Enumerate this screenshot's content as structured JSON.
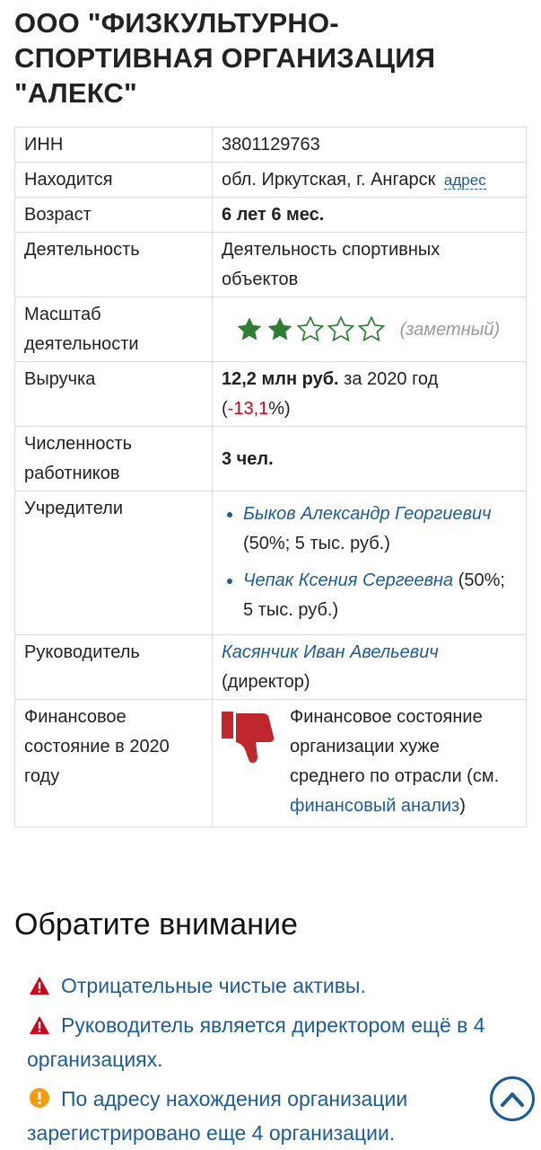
{
  "page_title": "ООО \"ФИЗКУЛЬТУРНО-СПОРТИВНАЯ ОРГАНИЗАЦИЯ \"АЛЕКС\"",
  "info": {
    "inn": {
      "label": "ИНН",
      "value": "3801129763"
    },
    "location": {
      "label": "Находится",
      "value": "обл. Иркутская, г. Ангарск",
      "link": "адрес"
    },
    "age": {
      "label": "Возраст",
      "value": "6 лет 6 мес."
    },
    "activity": {
      "label": "Деятельность",
      "value": "Деятельность спортивных объектов"
    },
    "scale": {
      "label": "Масштаб деятельности",
      "rating": 2,
      "max": 5,
      "note": "(заметный)"
    },
    "revenue": {
      "label": "Выручка",
      "amount": "12,2 млн руб.",
      "period": "за 2020 год",
      "open": "(",
      "change": "-13,1",
      "close": "%)"
    },
    "employees": {
      "label": "Численность работников",
      "value": "3 чел."
    },
    "founders": {
      "label": "Учредители",
      "items": [
        {
          "name": "Быков Александр Георгиевич",
          "share": "(50%; 5 тыс. руб.)"
        },
        {
          "name": "Чепак Ксения Сергеевна",
          "share": "(50%; 5 тыс. руб.)"
        }
      ]
    },
    "director": {
      "label": "Руководитель",
      "name": "Касянчик Иван Авельевич",
      "role": "(директор)"
    },
    "finance": {
      "label": "Финансовое состояние в 2020 году",
      "text": "Финансовое состояние организации хуже среднего по отрасли (см.",
      "link": "финансовый анализ",
      "close": ")"
    }
  },
  "attention": {
    "heading": "Обратите внимание",
    "items": [
      {
        "icon": "warning-triangle-icon",
        "text": "Отрицательные чистые активы."
      },
      {
        "icon": "warning-triangle-icon",
        "text": "Руководитель является директором ещё в 4 организациях."
      },
      {
        "icon": "info-circle-icon",
        "text": "По адресу нахождения организации зарегистрировано еще 4 организации."
      }
    ]
  },
  "colors": {
    "link": "#1d5c96",
    "star": "#2e7d32",
    "negative": "#d0021b",
    "thumb": "#c0262d",
    "warn": "#d0021b",
    "info": "#f39c12"
  }
}
